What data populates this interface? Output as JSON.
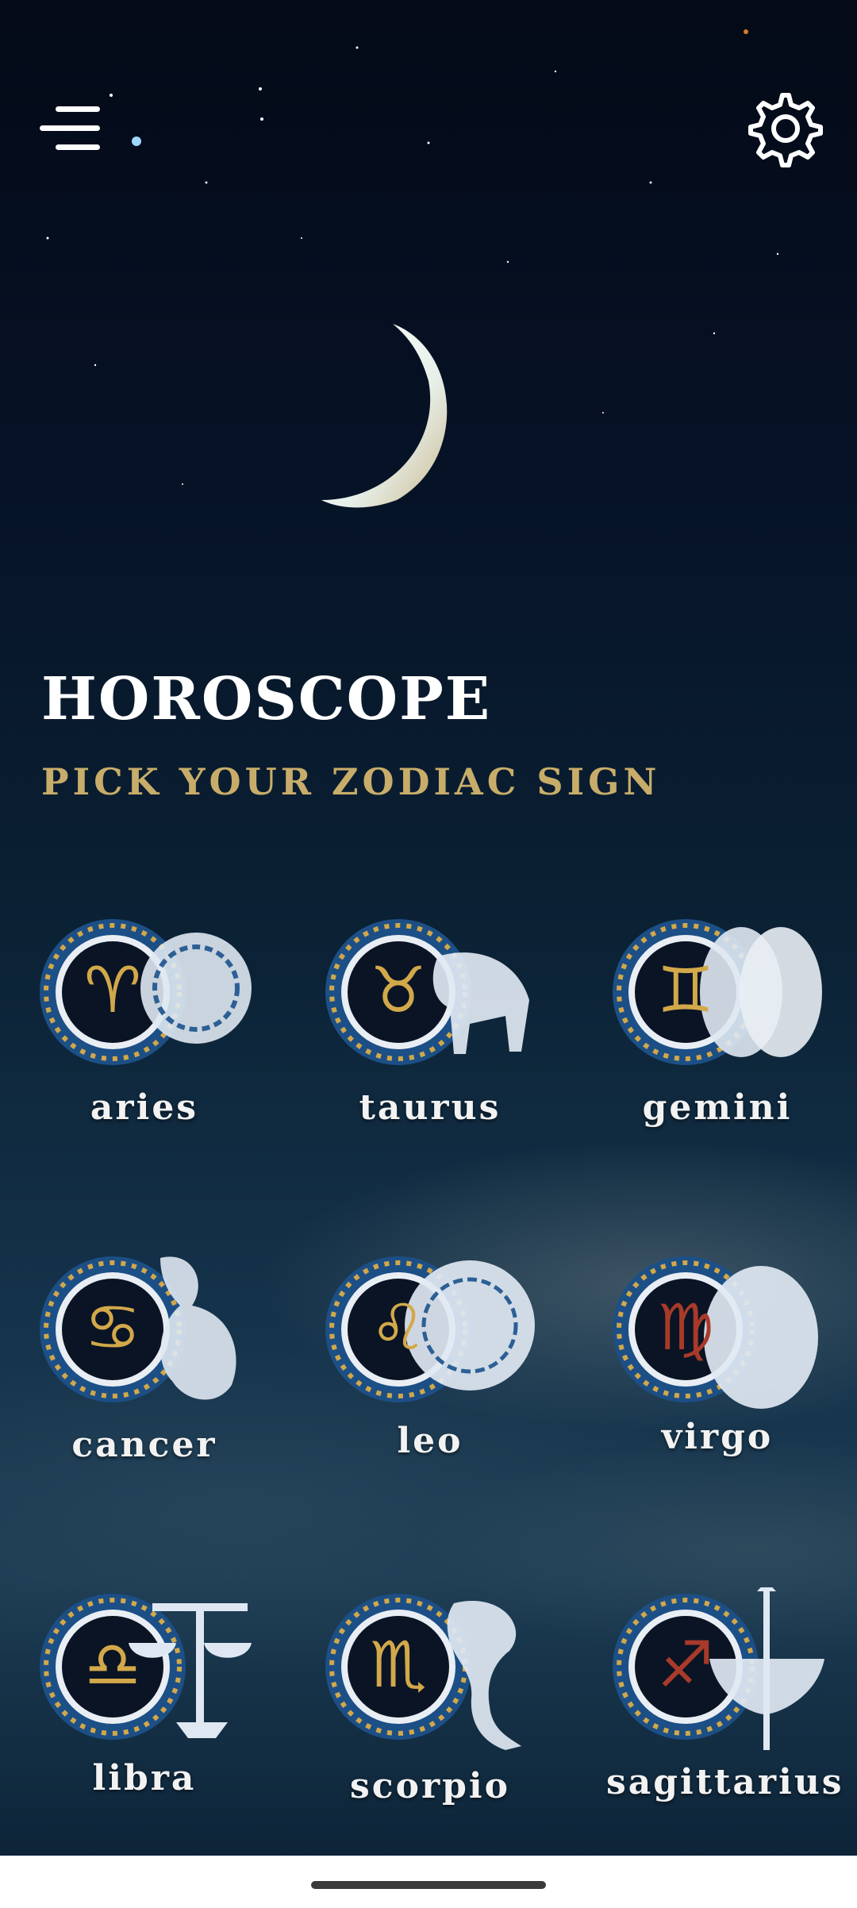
{
  "header": {
    "menu_icon": "hamburger-menu-icon",
    "settings_icon": "gear-icon"
  },
  "hero": {
    "title": "HOROSCOPE",
    "subtitle": "PICK YOUR ZODIAC SIGN"
  },
  "signs": [
    {
      "label": "aries",
      "glyph": "♈"
    },
    {
      "label": "taurus",
      "glyph": "♉"
    },
    {
      "label": "gemini",
      "glyph": "♊"
    },
    {
      "label": "cancer",
      "glyph": "♋"
    },
    {
      "label": "leo",
      "glyph": "♌"
    },
    {
      "label": "virgo",
      "glyph": "♍"
    },
    {
      "label": "libra",
      "glyph": "♎"
    },
    {
      "label": "scorpio",
      "glyph": "♏"
    },
    {
      "label": "sagittarius",
      "glyph": "♐"
    }
  ],
  "colors": {
    "background_top": "#040a17",
    "background_bottom": "#1b3b52",
    "title": "#ffffff",
    "subtitle_gold": "#c8ad6a",
    "emblem_ring_blue": "#2e6fb0",
    "emblem_gold": "#d2a84a"
  }
}
